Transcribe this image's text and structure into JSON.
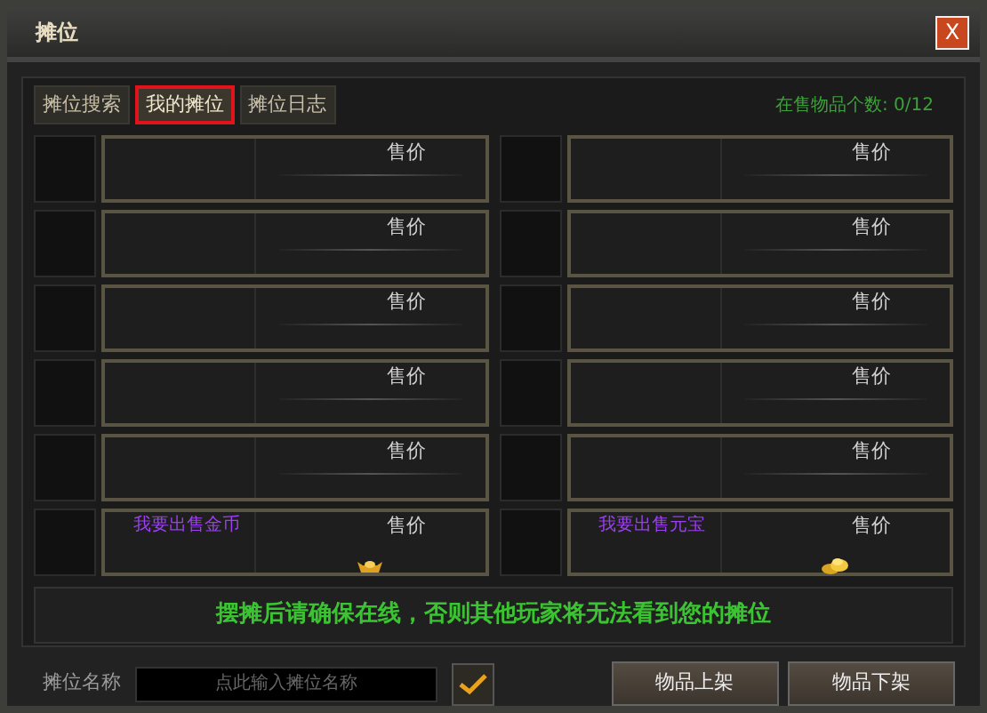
{
  "window": {
    "title": "摊位",
    "close": "X"
  },
  "tabs": [
    {
      "label": "摊位搜索",
      "selected": false
    },
    {
      "label": "我的摊位",
      "selected": true
    },
    {
      "label": "摊位日志",
      "selected": false
    }
  ],
  "items_on_sale": "在售物品个数: 0/12",
  "slots": [
    {
      "price_label": "售价",
      "kind": "empty"
    },
    {
      "price_label": "售价",
      "kind": "empty"
    },
    {
      "price_label": "售价",
      "kind": "empty"
    },
    {
      "price_label": "售价",
      "kind": "empty"
    },
    {
      "price_label": "售价",
      "kind": "empty"
    },
    {
      "price_label": "售价",
      "kind": "empty"
    },
    {
      "price_label": "售价",
      "kind": "empty"
    },
    {
      "price_label": "售价",
      "kind": "empty"
    },
    {
      "price_label": "售价",
      "kind": "empty"
    },
    {
      "price_label": "售价",
      "kind": "empty"
    },
    {
      "price_label": "售价",
      "kind": "ingot",
      "offer": "我要出售金币"
    },
    {
      "price_label": "售价",
      "kind": "coins",
      "offer": "我要出售元宝"
    }
  ],
  "notice": "摆摊后请确保在线，否则其他玩家将无法看到您的摊位",
  "stall_name": {
    "label": "摊位名称",
    "placeholder": "点此输入摊位名称",
    "checked": true
  },
  "buttons": [
    "物品上架",
    "物品下架"
  ]
}
